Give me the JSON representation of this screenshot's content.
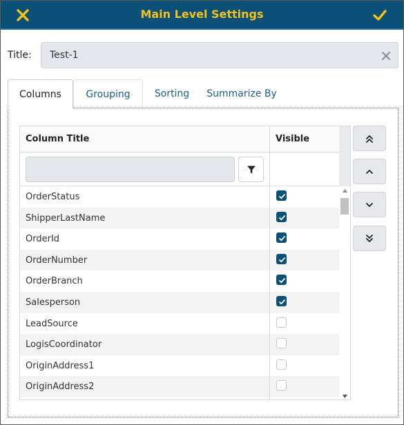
{
  "header": {
    "title": "Main Level Settings",
    "close_icon": "close-icon",
    "confirm_icon": "check-icon",
    "background": "#0b5177",
    "title_color": "#f4c21a"
  },
  "title_field": {
    "label": "Title:",
    "value": "Test-1",
    "clear_icon": "clear-icon"
  },
  "tabs": [
    {
      "label": "Columns",
      "active": true
    },
    {
      "label": "Grouping",
      "active": false
    },
    {
      "label": "Sorting",
      "active": false
    },
    {
      "label": "Summarize By",
      "active": false
    }
  ],
  "grid": {
    "columns": [
      "Column Title",
      "Visible"
    ],
    "filter_value": "",
    "filter_icon": "filter-icon",
    "rows": [
      {
        "name": "OrderStatus",
        "visible": true
      },
      {
        "name": "ShipperLastName",
        "visible": true
      },
      {
        "name": "OrderId",
        "visible": true
      },
      {
        "name": "OrderNumber",
        "visible": true
      },
      {
        "name": "OrderBranch",
        "visible": true
      },
      {
        "name": "Salesperson",
        "visible": true
      },
      {
        "name": "LeadSource",
        "visible": false
      },
      {
        "name": "LogisCoordinator",
        "visible": false
      },
      {
        "name": "OriginAddress1",
        "visible": false
      },
      {
        "name": "OriginAddress2",
        "visible": false
      }
    ]
  },
  "move_buttons": [
    {
      "action": "move-to-top",
      "icon": "double-chevron-up-icon"
    },
    {
      "action": "move-up",
      "icon": "chevron-up-icon"
    },
    {
      "action": "move-down",
      "icon": "chevron-down-icon"
    },
    {
      "action": "move-to-bottom",
      "icon": "double-chevron-down-icon"
    }
  ],
  "colors": {
    "accent": "#0b5177",
    "link": "#1c5f86",
    "checkbox_on": "#0b5177"
  }
}
